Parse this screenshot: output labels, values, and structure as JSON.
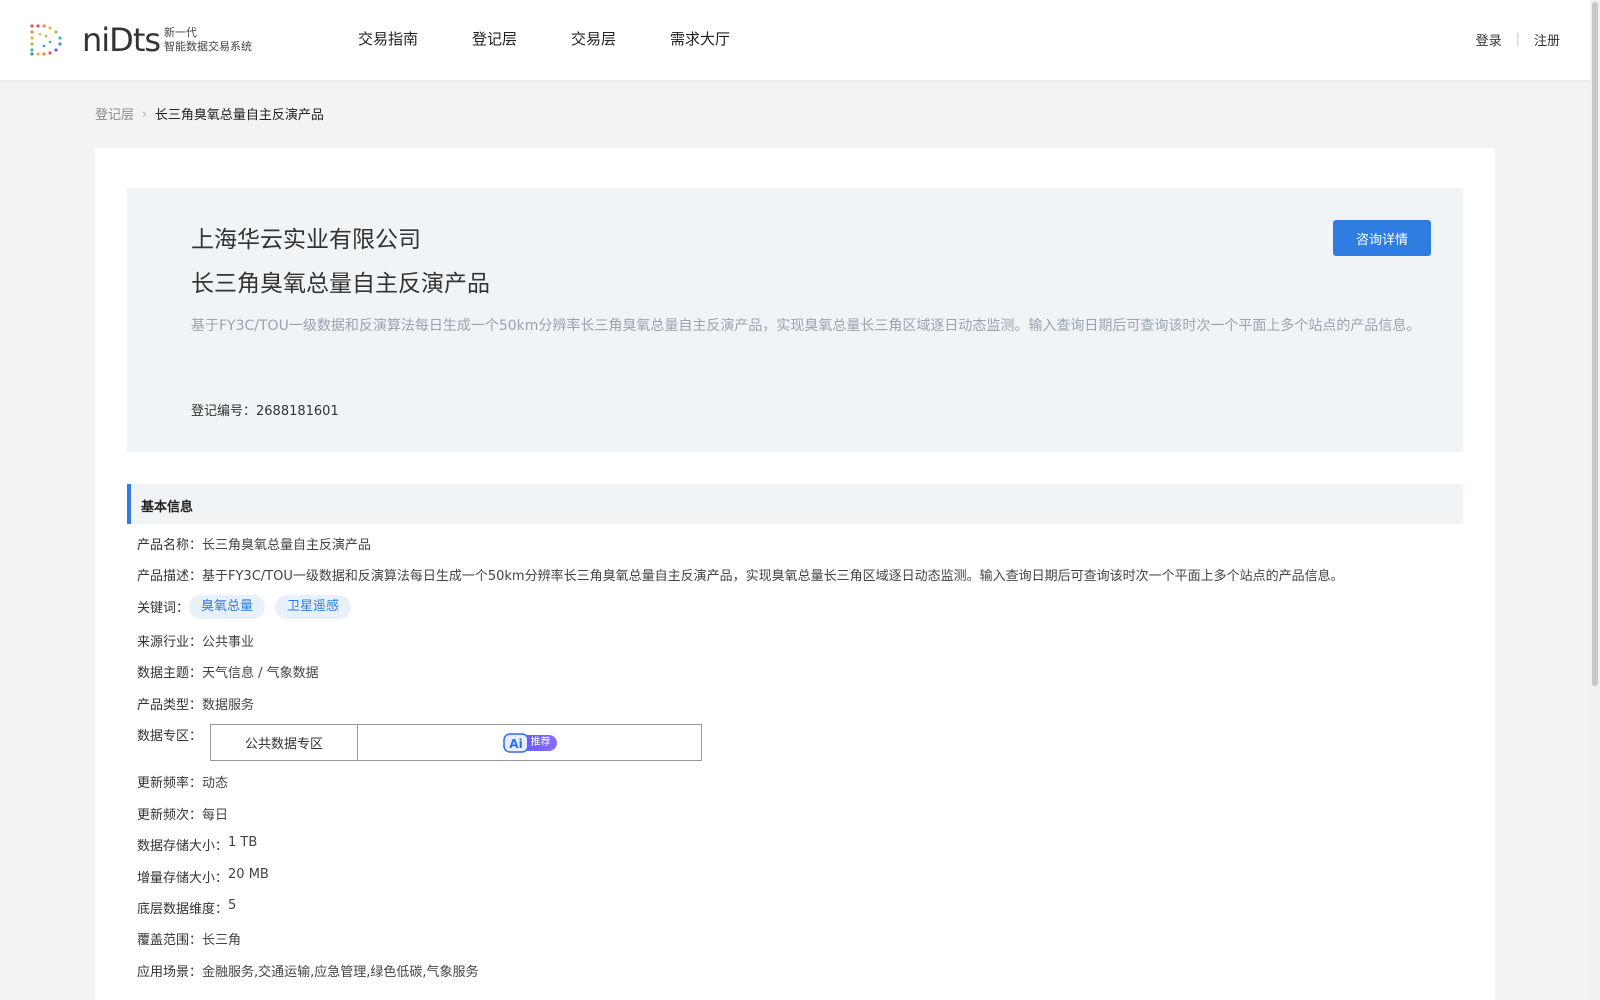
{
  "header": {
    "logo_word": "niDts",
    "logo_sub_line1": "新一代",
    "logo_sub_line2": "智能数据交易系统",
    "nav": [
      "交易指南",
      "登记层",
      "交易层",
      "需求大厅"
    ],
    "login": "登录",
    "separator": "|",
    "register": "注册"
  },
  "breadcrumb": {
    "parent": "登记层",
    "separator": "›",
    "current": "长三角臭氧总量自主反演产品"
  },
  "hero": {
    "company": "上海华云实业有限公司",
    "product": "长三角臭氧总量自主反演产品",
    "description": "基于FY3C/TOU一级数据和反演算法每日生成一个50km分辨率长三角臭氧总量自主反演产品，实现臭氧总量长三角区域逐日动态监测。输入查询日期后可查询该时次一个平面上多个站点的产品信息。",
    "reg_label": "登记编号：",
    "reg_value": "2688181601",
    "consult_button": "咨询详情"
  },
  "basic": {
    "section_title": "基本信息",
    "name_label": "产品名称：",
    "name_value": "长三角臭氧总量自主反演产品",
    "desc_label": "产品描述：",
    "desc_value": "基于FY3C/TOU一级数据和反演算法每日生成一个50km分辨率长三角臭氧总量自主反演产品，实现臭氧总量长三角区域逐日动态监测。输入查询日期后可查询该时次一个平面上多个站点的产品信息。",
    "keywords_label": "关键词：",
    "keywords": [
      "臭氧总量",
      "卫星遥感"
    ],
    "industry_label": "来源行业：",
    "industry_value": "公共事业",
    "theme_label": "数据主题：",
    "theme_value": "天气信息 / 气象数据",
    "type_label": "产品类型：",
    "type_value": "数据服务",
    "zone_label": "数据专区：",
    "zone_value": "公共数据专区",
    "ai_logo": "Ai",
    "ai_text": "推荐",
    "freq_label": "更新频率：",
    "freq_value": "动态",
    "freq2_label": "更新频次：",
    "freq2_value": "每日",
    "storage_label": "数据存储大小：",
    "storage_value": "1 TB",
    "inc_label": "增量存储大小：",
    "inc_value": "20 MB",
    "dim_label": "底层数据维度：",
    "dim_value": "5",
    "coverage_label": "覆盖范围：",
    "coverage_value": "长三角",
    "scenario_label": "应用场景：",
    "scenario_value": "金融服务,交通运输,应急管理,绿色低碳,气象服务"
  },
  "colors": {
    "accent": "#2f7de1",
    "hero_bg": "#f0f4f7",
    "page_bg": "#f2f3f5"
  }
}
